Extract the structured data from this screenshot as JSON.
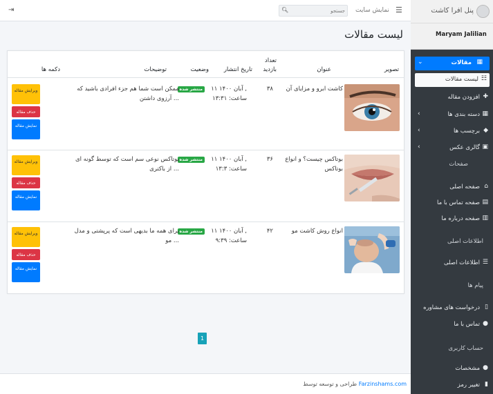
{
  "topbar": {
    "search_placeholder": "جستجو",
    "view_site": "نمایش سایت",
    "menu_icon": "bars-icon",
    "logout_icon": "sign-out-icon"
  },
  "sidebar": {
    "brand": "پنل افرا کاشت",
    "user": "Maryam Jalilian",
    "articles": "مقالات",
    "articles_list": "لیست مقالات",
    "add_article": "افزودن مقاله",
    "categories": "دسته بندی ها",
    "tags": "برچسب ها",
    "gallery": "گالری عکس",
    "pages_header": "صفحات",
    "home_page": "صفحه اصلی",
    "contact_page": "صفحه تماس با ما",
    "about_page": "صفحه درباره ما",
    "info_header": "اطلاعات اصلی",
    "main_info": "اطلاعات اصلی",
    "messages_header": "پیام ها",
    "consult_requests": "درخواست های مشاوره",
    "contact_us": "تماس با ما",
    "account_header": "حساب کاربری",
    "profile": "مشخصات",
    "change_password": "تغییر رمز"
  },
  "main": {
    "title": "لیست مقالات",
    "columns": {
      "image": "تصویر",
      "title": "عنوان",
      "views_1": "تعداد",
      "views_2": "بازدید",
      "date": "تاریخ انتشار",
      "status": "وضعیت",
      "description": "توضیحات",
      "buttons": "دکمه ها"
    },
    "rows": [
      {
        "title": "کاشت ابرو و مزایای آن",
        "views": "۳۸",
        "date_1": "۱۱ آبان ۱۴۰۰ ,",
        "date_2": "ساعت: ۱۳:۳۱",
        "status": "منتشر شده",
        "desc_1": "ممکن است شما هم جزء افرادی باشید که",
        "desc_2": "آرزوی داشتن ...",
        "edit": "ویرایش مقاله",
        "delete": "حذف مقاله",
        "view": "نمایش مقاله"
      },
      {
        "title_1": "بوتاکس چیست؟ و انواع",
        "title_2": "بوتاکس",
        "views": "۳۶",
        "date_1": "۱۱ آبان ۱۴۰۰ ,",
        "date_2": "ساعت: ۱۳:۳",
        "status": "منتشر شده",
        "desc_1": "بوتاکس نوعی سم است که توسط گونه ای",
        "desc_2": "از باکتری ...",
        "edit": "ویرایش مقاله",
        "delete": "حذف مقاله",
        "view": "نمایش مقاله"
      },
      {
        "title": "انواع روش کاشت مو",
        "views": "۴۲",
        "date_1": "۱۱ آبان ۱۴۰۰ ,",
        "date_2": "ساعت: ۹:۳۹",
        "status": "منتشر شده",
        "desc_1": "برای همه ما بدیهی است که پرپشتی و مدل",
        "desc_2": "مو ...",
        "edit": "ویرایش مقاله",
        "delete": "حذف مقاله",
        "view": "نمایش مقاله"
      }
    ],
    "pagination": "1"
  },
  "footer": {
    "prefix": "طراحی و توسعه توسط",
    "link": "Farzinshams.com"
  },
  "colors": {
    "primary": "#007bff",
    "success": "#28a745",
    "danger": "#dc3545",
    "warning": "#ffc107",
    "info": "#17a2b8",
    "sidebar": "#343a40"
  }
}
